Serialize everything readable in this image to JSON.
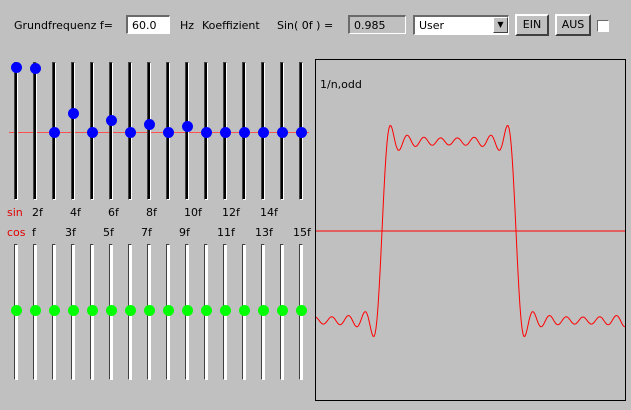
{
  "header": {
    "freq_label": "Grundfrequenz f=",
    "freq_value": "60.0",
    "unit": "Hz",
    "coef_label": "Koeffizient",
    "sin_label": "Sin( 0f ) =",
    "coef_value": "0.985",
    "preset": "User",
    "ein_label": "EIN",
    "aus_label": "AUS",
    "checkbox_checked": false
  },
  "sin": {
    "row_label": "sin",
    "harmonic_labels": [
      "2f",
      "4f",
      "6f",
      "8f",
      "10f",
      "12f",
      "14f"
    ],
    "levels": [
      1.0,
      0.985,
      0,
      0.3,
      0,
      0.18,
      0,
      0.13,
      0,
      0.1,
      0,
      0,
      0,
      0,
      0,
      0
    ]
  },
  "cos": {
    "row_label": "cos",
    "harmonic_labels": [
      "f",
      "3f",
      "5f",
      "7f",
      "9f",
      "11f",
      "13f",
      "15f"
    ],
    "levels": [
      0,
      0,
      0,
      0,
      0,
      0,
      0,
      0,
      0,
      0,
      0,
      0,
      0,
      0,
      0,
      0
    ]
  },
  "plot": {
    "label": "1/n,odd"
  },
  "colors": {
    "background": "#c0c0c0",
    "sin_knob": "#0000ff",
    "cos_knob": "#00ff00",
    "wave": "#ff0000",
    "axis": "#ff0000",
    "label_red": "#e00000"
  }
}
